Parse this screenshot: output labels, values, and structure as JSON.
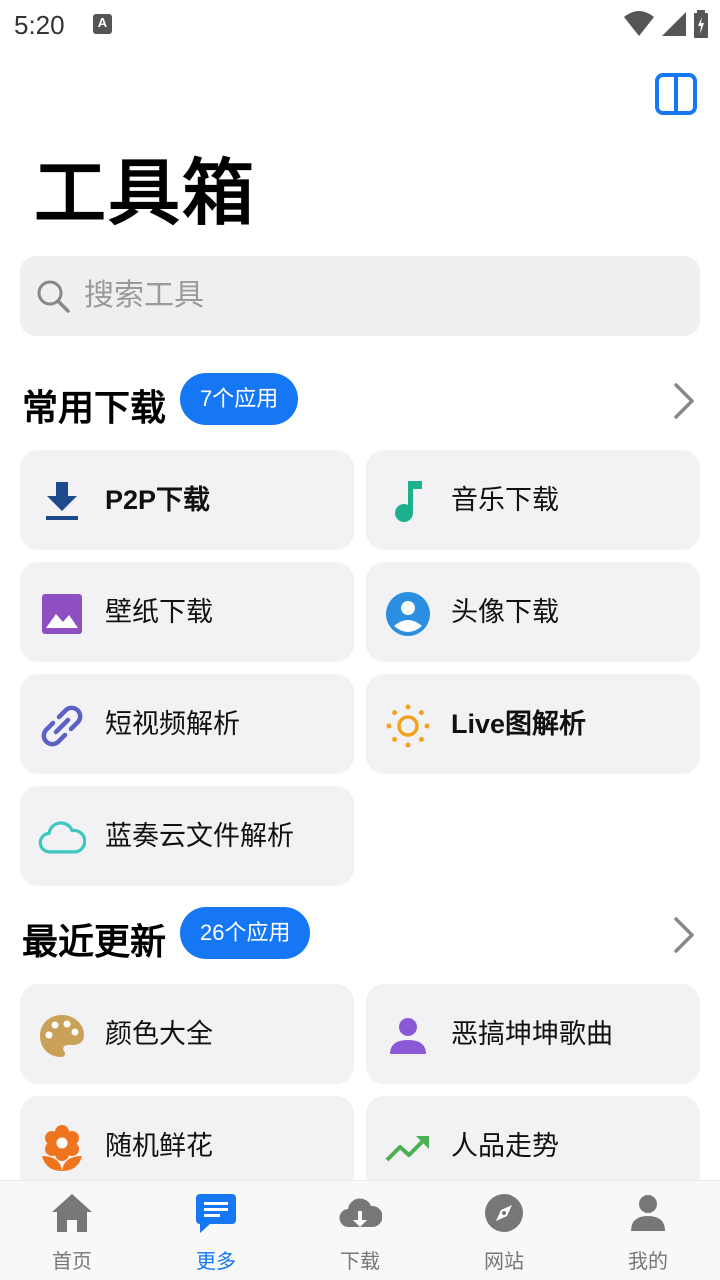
{
  "status_bar": {
    "time": "5:20",
    "notif_letter": "A"
  },
  "title": "工具箱",
  "search": {
    "placeholder": "搜索工具"
  },
  "sections": [
    {
      "title": "常用下载",
      "badge": "7个应用",
      "items": [
        {
          "label": "P2P下载",
          "icon": "download-icon",
          "color": "#1c4a8c"
        },
        {
          "label": "音乐下载",
          "icon": "music-note-icon",
          "color": "#1fb08e"
        },
        {
          "label": "壁纸下载",
          "icon": "image-icon",
          "color": "#8e4fc2"
        },
        {
          "label": "头像下载",
          "icon": "account-circle-icon",
          "color": "#2a8fe0"
        },
        {
          "label": "短视频解析",
          "icon": "link-icon",
          "color": "#5b62c4"
        },
        {
          "label": "Live图解析",
          "icon": "sun-icon",
          "color": "#f2a21c"
        },
        {
          "label": "蓝奏云文件解析",
          "icon": "cloud-icon",
          "color": "#3cc7c0"
        }
      ]
    },
    {
      "title": "最近更新",
      "badge": "26个应用",
      "items": [
        {
          "label": "颜色大全",
          "icon": "palette-icon",
          "color": "#c9a158"
        },
        {
          "label": "恶搞坤坤歌曲",
          "icon": "person-icon",
          "color": "#8a5ad6"
        },
        {
          "label": "随机鲜花",
          "icon": "flower-icon",
          "color": "#f0741e"
        },
        {
          "label": "人品走势",
          "icon": "trending-up-icon",
          "color": "#4caf50"
        }
      ]
    }
  ],
  "nav": [
    {
      "label": "首页",
      "icon": "home-icon"
    },
    {
      "label": "更多",
      "icon": "chat-icon"
    },
    {
      "label": "下载",
      "icon": "cloud-download-icon"
    },
    {
      "label": "网站",
      "icon": "compass-icon"
    },
    {
      "label": "我的",
      "icon": "user-icon"
    }
  ],
  "nav_active": "更多",
  "colors": {
    "accent": "#1677f5",
    "card_bg": "#f2f2f4",
    "search_bg": "#efefef",
    "nav_inactive": "#777777"
  }
}
